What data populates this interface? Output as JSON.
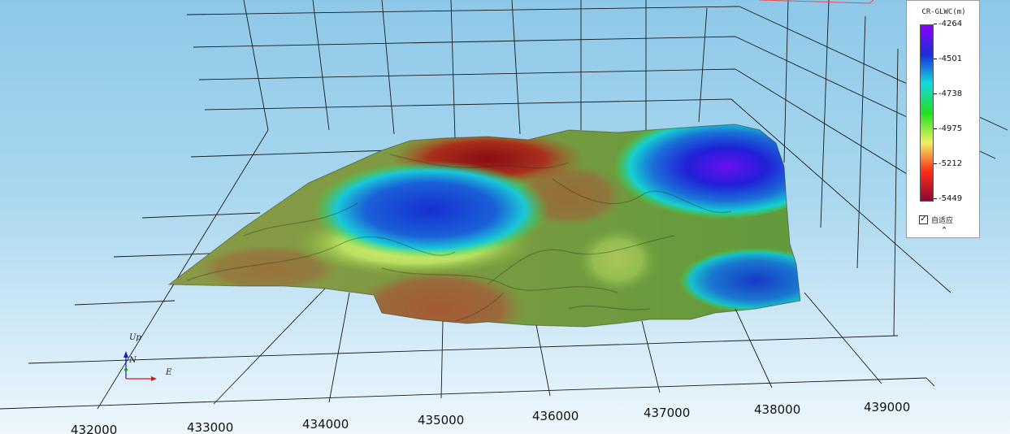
{
  "viewer": {
    "x_axis_labels": [
      "432000",
      "433000",
      "434000",
      "435000",
      "436000",
      "437000",
      "438000",
      "439000"
    ],
    "orientation": {
      "up_label": "Up",
      "north_label": "N",
      "east_label": "E"
    }
  },
  "legend": {
    "title": "CR-GLWC(m)",
    "ticks": [
      "-4264",
      "-4501",
      "-4738",
      "-4975",
      "-5212",
      "-5449"
    ],
    "colors": [
      "#8a00ff",
      "#1a2fd8",
      "#12d9e0",
      "#20e020",
      "#f0f060",
      "#ff3018",
      "#8a0a30"
    ],
    "adaptive_label": "自适应",
    "adaptive_checked": true,
    "collapse_icon": "chevron-up-icon"
  }
}
